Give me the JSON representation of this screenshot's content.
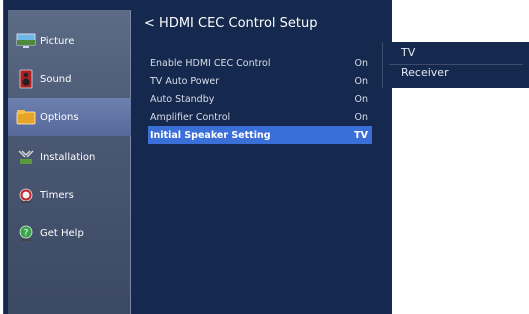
{
  "sidebar": {
    "items": [
      {
        "label": "Picture",
        "icon": "picture-icon",
        "active": false
      },
      {
        "label": "Sound",
        "icon": "speaker-icon",
        "active": false
      },
      {
        "label": "Options",
        "icon": "options-icon",
        "active": true
      },
      {
        "label": "Installation",
        "icon": "installation-icon",
        "active": false
      },
      {
        "label": "Timers",
        "icon": "alarm-icon",
        "active": false
      },
      {
        "label": "Get Help",
        "icon": "help-icon",
        "active": false
      }
    ]
  },
  "header": {
    "back_glyph": "<",
    "title": "HDMI CEC Control Setup"
  },
  "settings": [
    {
      "label": "Enable HDMI CEC Control",
      "value": "On"
    },
    {
      "label": "TV Auto Power",
      "value": "On"
    },
    {
      "label": "Auto Standby",
      "value": "On"
    },
    {
      "label": "Amplifier Control",
      "value": "On"
    },
    {
      "label": "Initial Speaker Setting",
      "value": "TV",
      "selected": true
    }
  ],
  "popup": {
    "options": [
      "TV",
      "Receiver"
    ]
  },
  "colors": {
    "panel": "#15294e",
    "sidebar": "#4a5874",
    "highlight": "#3a6fd8",
    "active_item": "#5e72a6"
  }
}
